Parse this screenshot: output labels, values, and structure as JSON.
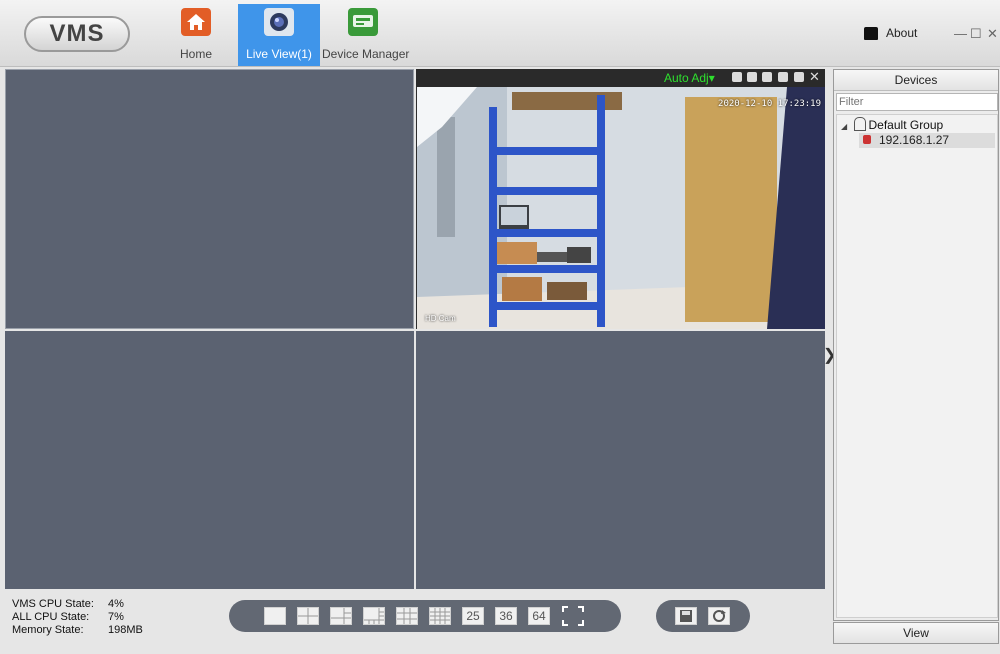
{
  "app": {
    "logo": "VMS"
  },
  "nav": [
    {
      "label": "Home",
      "icon": "home-icon"
    },
    {
      "label": "Live View(1)",
      "icon": "camera-lens-icon",
      "active": true
    },
    {
      "label": "Device Manager",
      "icon": "device-manager-icon"
    }
  ],
  "header": {
    "about_label": "About",
    "minimize": "—",
    "maximize": "☐",
    "close": "✕"
  },
  "camera": {
    "auto_adjust_label": "Auto Adj▾",
    "timestamp": "2020-12-10 17:23:19",
    "label": "HD Cam"
  },
  "devices": {
    "title": "Devices",
    "filter_placeholder": "Filter",
    "group": "Default Group",
    "device": "192.168.1.27",
    "view_label": "View"
  },
  "stats": {
    "vms_cpu_label": "VMS CPU State:",
    "vms_cpu_value": "4%",
    "all_cpu_label": "ALL CPU State:",
    "all_cpu_value": "7%",
    "memory_label": "Memory State:",
    "memory_value": "198MB"
  },
  "layouts": {
    "l25": "25",
    "l36": "36",
    "l64": "64"
  },
  "colors": {
    "accent": "#3f95ea",
    "cell": "#5b6271",
    "toolbar": "#626873",
    "osd_green": "#2ee02e"
  }
}
